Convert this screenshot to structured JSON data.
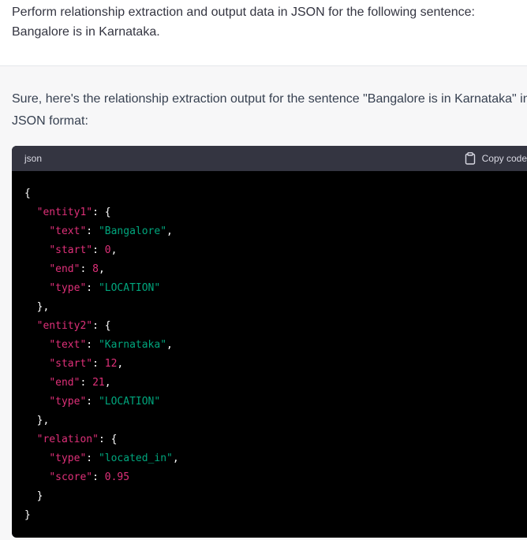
{
  "user_message": {
    "text": "Perform relationship extraction and output data in JSON for the following sentence: Bangalore is in Karnataka."
  },
  "assistant_message": {
    "intro": "Sure, here's the relationship extraction output for the sentence \"Bangalore is in Karnataka\" in JSON format:",
    "code_block": {
      "language": "json",
      "copy_label": "Copy code",
      "copy_icon": "clipboard-icon",
      "colors": {
        "key": "#df3079",
        "string": "#00a67d",
        "number": "#df3079",
        "punctuation": "#ffffff"
      },
      "lines": [
        [
          {
            "t": "p",
            "v": "{"
          }
        ],
        [
          {
            "t": "p",
            "v": "  "
          },
          {
            "t": "k",
            "v": "\"entity1\""
          },
          {
            "t": "p",
            "v": ": {"
          }
        ],
        [
          {
            "t": "p",
            "v": "    "
          },
          {
            "t": "k",
            "v": "\"text\""
          },
          {
            "t": "p",
            "v": ": "
          },
          {
            "t": "s",
            "v": "\"Bangalore\""
          },
          {
            "t": "p",
            "v": ","
          }
        ],
        [
          {
            "t": "p",
            "v": "    "
          },
          {
            "t": "k",
            "v": "\"start\""
          },
          {
            "t": "p",
            "v": ": "
          },
          {
            "t": "n",
            "v": "0"
          },
          {
            "t": "p",
            "v": ","
          }
        ],
        [
          {
            "t": "p",
            "v": "    "
          },
          {
            "t": "k",
            "v": "\"end\""
          },
          {
            "t": "p",
            "v": ": "
          },
          {
            "t": "n",
            "v": "8"
          },
          {
            "t": "p",
            "v": ","
          }
        ],
        [
          {
            "t": "p",
            "v": "    "
          },
          {
            "t": "k",
            "v": "\"type\""
          },
          {
            "t": "p",
            "v": ": "
          },
          {
            "t": "s",
            "v": "\"LOCATION\""
          }
        ],
        [
          {
            "t": "p",
            "v": "  },"
          }
        ],
        [
          {
            "t": "p",
            "v": "  "
          },
          {
            "t": "k",
            "v": "\"entity2\""
          },
          {
            "t": "p",
            "v": ": {"
          }
        ],
        [
          {
            "t": "p",
            "v": "    "
          },
          {
            "t": "k",
            "v": "\"text\""
          },
          {
            "t": "p",
            "v": ": "
          },
          {
            "t": "s",
            "v": "\"Karnataka\""
          },
          {
            "t": "p",
            "v": ","
          }
        ],
        [
          {
            "t": "p",
            "v": "    "
          },
          {
            "t": "k",
            "v": "\"start\""
          },
          {
            "t": "p",
            "v": ": "
          },
          {
            "t": "n",
            "v": "12"
          },
          {
            "t": "p",
            "v": ","
          }
        ],
        [
          {
            "t": "p",
            "v": "    "
          },
          {
            "t": "k",
            "v": "\"end\""
          },
          {
            "t": "p",
            "v": ": "
          },
          {
            "t": "n",
            "v": "21"
          },
          {
            "t": "p",
            "v": ","
          }
        ],
        [
          {
            "t": "p",
            "v": "    "
          },
          {
            "t": "k",
            "v": "\"type\""
          },
          {
            "t": "p",
            "v": ": "
          },
          {
            "t": "s",
            "v": "\"LOCATION\""
          }
        ],
        [
          {
            "t": "p",
            "v": "  },"
          }
        ],
        [
          {
            "t": "p",
            "v": "  "
          },
          {
            "t": "k",
            "v": "\"relation\""
          },
          {
            "t": "p",
            "v": ": {"
          }
        ],
        [
          {
            "t": "p",
            "v": "    "
          },
          {
            "t": "k",
            "v": "\"type\""
          },
          {
            "t": "p",
            "v": ": "
          },
          {
            "t": "s",
            "v": "\"located_in\""
          },
          {
            "t": "p",
            "v": ","
          }
        ],
        [
          {
            "t": "p",
            "v": "    "
          },
          {
            "t": "k",
            "v": "\"score\""
          },
          {
            "t": "p",
            "v": ": "
          },
          {
            "t": "n",
            "v": "0.95"
          }
        ],
        [
          {
            "t": "p",
            "v": "  }"
          }
        ],
        [
          {
            "t": "p",
            "v": "}"
          }
        ]
      ]
    }
  }
}
